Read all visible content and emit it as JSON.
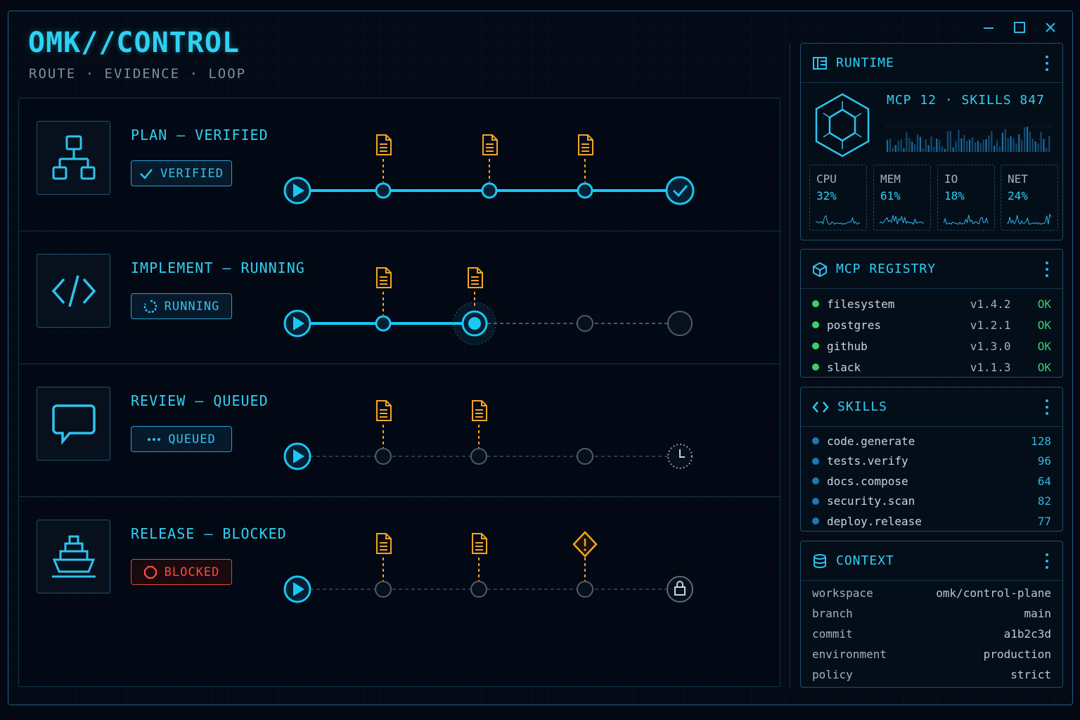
{
  "app": {
    "title": "OMK//CONTROL",
    "subtitle": "ROUTE · EVIDENCE · LOOP"
  },
  "stages": [
    {
      "title": "PLAN – VERIFIED",
      "status": "VERIFIED",
      "state": "verified",
      "icon": "hierarchy-icon"
    },
    {
      "title": "IMPLEMENT – RUNNING",
      "status": "RUNNING",
      "state": "running",
      "icon": "code-icon"
    },
    {
      "title": "REVIEW – QUEUED",
      "status": "QUEUED",
      "state": "queued",
      "icon": "chat-bubble-icon"
    },
    {
      "title": "RELEASE – BLOCKED",
      "status": "BLOCKED",
      "state": "blocked",
      "icon": "ship-icon"
    }
  ],
  "runtime": {
    "title": "RUNTIME",
    "stats": "MCP 12 · SKILLS 847",
    "metrics": [
      {
        "label": "CPU",
        "value": "32%"
      },
      {
        "label": "MEM",
        "value": "61%"
      },
      {
        "label": "IO",
        "value": "18%"
      },
      {
        "label": "NET",
        "value": "24%"
      }
    ]
  },
  "registry": {
    "title": "MCP REGISTRY",
    "items": [
      {
        "name": "filesystem",
        "version": "v1.4.2",
        "status": "OK"
      },
      {
        "name": "postgres",
        "version": "v1.2.1",
        "status": "OK"
      },
      {
        "name": "github",
        "version": "v1.3.0",
        "status": "OK"
      },
      {
        "name": "slack",
        "version": "v1.1.3",
        "status": "OK"
      }
    ]
  },
  "skills": {
    "title": "SKILLS",
    "items": [
      {
        "name": "code.generate",
        "count": "128"
      },
      {
        "name": "tests.verify",
        "count": "96"
      },
      {
        "name": "docs.compose",
        "count": "64"
      },
      {
        "name": "security.scan",
        "count": "82"
      },
      {
        "name": "deploy.release",
        "count": "77"
      }
    ]
  },
  "context": {
    "title": "CONTEXT",
    "items": [
      {
        "key": "workspace",
        "value": "omk/control-plane"
      },
      {
        "key": "branch",
        "value": "main"
      },
      {
        "key": "commit",
        "value": "a1b2c3d"
      },
      {
        "key": "environment",
        "value": "production"
      },
      {
        "key": "policy",
        "value": "strict"
      }
    ]
  },
  "colors": {
    "accent": "#2fd1f2",
    "evidence": "#f5a623",
    "ok": "#39d06b",
    "blocked": "#ff4a3f"
  }
}
